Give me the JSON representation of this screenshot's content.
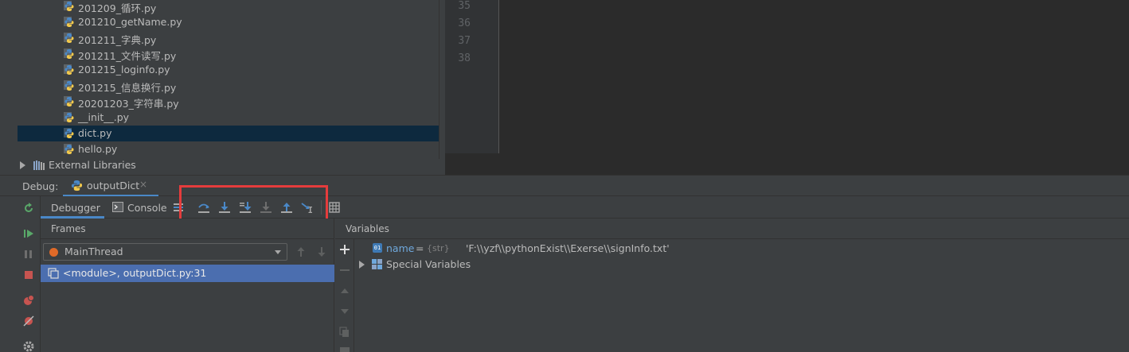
{
  "project_tree": {
    "files": [
      {
        "name": "201209_循环.py"
      },
      {
        "name": "201210_getName.py"
      },
      {
        "name": "201211_字典.py"
      },
      {
        "name": "201211_文件读写.py"
      },
      {
        "name": "201215_loginfo.py"
      },
      {
        "name": "201215_信息换行.py"
      },
      {
        "name": "20201203_字符串.py"
      },
      {
        "name": "__init__.py"
      },
      {
        "name": "dict.py",
        "selected": true
      },
      {
        "name": "hello.py"
      }
    ],
    "external_libraries": "External Libraries"
  },
  "editor": {
    "line_numbers": [
      "35",
      "36",
      "37",
      "38"
    ]
  },
  "debug": {
    "title": "Debug:",
    "run_tab": "outputDict",
    "close_icon": "×",
    "tabs": {
      "debugger": "Debugger",
      "console": "Console"
    },
    "toolbar_icons": [
      "step-over-icon",
      "step-into-icon",
      "step-into-my-code-icon",
      "force-step-into-icon",
      "step-out-icon",
      "run-to-cursor-icon",
      "evaluate-expression-icon"
    ],
    "frames": {
      "title": "Frames",
      "thread": "MainThread",
      "selected_frame": "<module>, outputDict.py:31"
    },
    "variables": {
      "title": "Variables",
      "items": [
        {
          "name": "name",
          "equals": "=",
          "type": "{str}",
          "value": "'F:\\\\yzf\\\\pythonExist\\\\Exerse\\\\signInfo.txt'"
        }
      ],
      "special": "Special Variables"
    }
  },
  "colors": {
    "accent": "#4a88c7",
    "highlight_box": "#e53c3c",
    "selection_tree": "#0d293e",
    "selection_frame": "#4b6eaf",
    "thread_dot": "#e06a28"
  }
}
